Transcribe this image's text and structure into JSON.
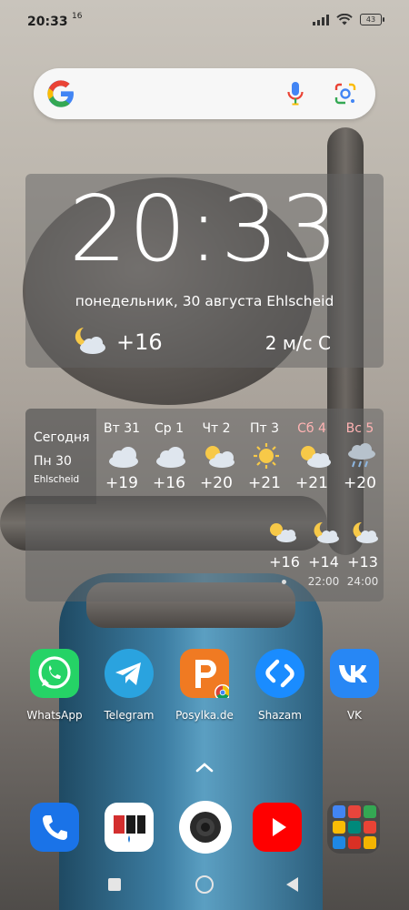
{
  "status_bar": {
    "time": "20:33",
    "notification": "16",
    "battery": "43"
  },
  "search": {
    "placeholder": ""
  },
  "clock_widget": {
    "time": "20:33",
    "date_location": "понедельник, 30 августа Ehlscheid",
    "temperature": "+16",
    "wind": "2 м/с С"
  },
  "forecast_widget": {
    "today_label": "Сегодня",
    "today_date": "Пн 30",
    "location": "Ehlscheid",
    "days": [
      {
        "label": "Вт 31",
        "icon": "cloud-icon",
        "temp": "+19",
        "weekend": false
      },
      {
        "label": "Ср 1",
        "icon": "cloud-icon",
        "temp": "+16",
        "weekend": false
      },
      {
        "label": "Чт 2",
        "icon": "partly-cloudy-icon",
        "temp": "+20",
        "weekend": false
      },
      {
        "label": "Пт 3",
        "icon": "sun-icon",
        "temp": "+21",
        "weekend": false
      },
      {
        "label": "Сб 4",
        "icon": "partly-cloudy-icon",
        "temp": "+21",
        "weekend": true
      },
      {
        "label": "Вс 5",
        "icon": "rain-icon",
        "temp": "+20",
        "weekend": true
      }
    ],
    "hourly": [
      {
        "icon": "partly-cloudy-icon",
        "temp": "+16",
        "time": ""
      },
      {
        "icon": "moon-cloud-icon",
        "temp": "+14",
        "time": "22:00"
      },
      {
        "icon": "moon-cloud-icon",
        "temp": "+13",
        "time": "24:00"
      }
    ]
  },
  "apps": [
    {
      "label": "WhatsApp",
      "icon": "whatsapp-icon",
      "color": "#25d366"
    },
    {
      "label": "Telegram",
      "icon": "telegram-icon",
      "color": "#2aa3df"
    },
    {
      "label": "Posylka.de",
      "icon": "posylka-icon",
      "color": "#f07a22"
    },
    {
      "label": "Shazam",
      "icon": "shazam-icon",
      "color": "#1a8cff"
    },
    {
      "label": "VK",
      "icon": "vk-icon",
      "color": "#2787f5"
    }
  ],
  "dock": [
    {
      "icon": "phone-icon",
      "color": "#1a73e8"
    },
    {
      "icon": "yap-icon",
      "color": "#ffffff"
    },
    {
      "icon": "camera-icon",
      "color": "#ffffff"
    },
    {
      "icon": "youtube-icon",
      "color": "#ff0000"
    }
  ],
  "colors": {
    "widget_bg": "#646464",
    "weekend_text": "#ffb3b3"
  }
}
